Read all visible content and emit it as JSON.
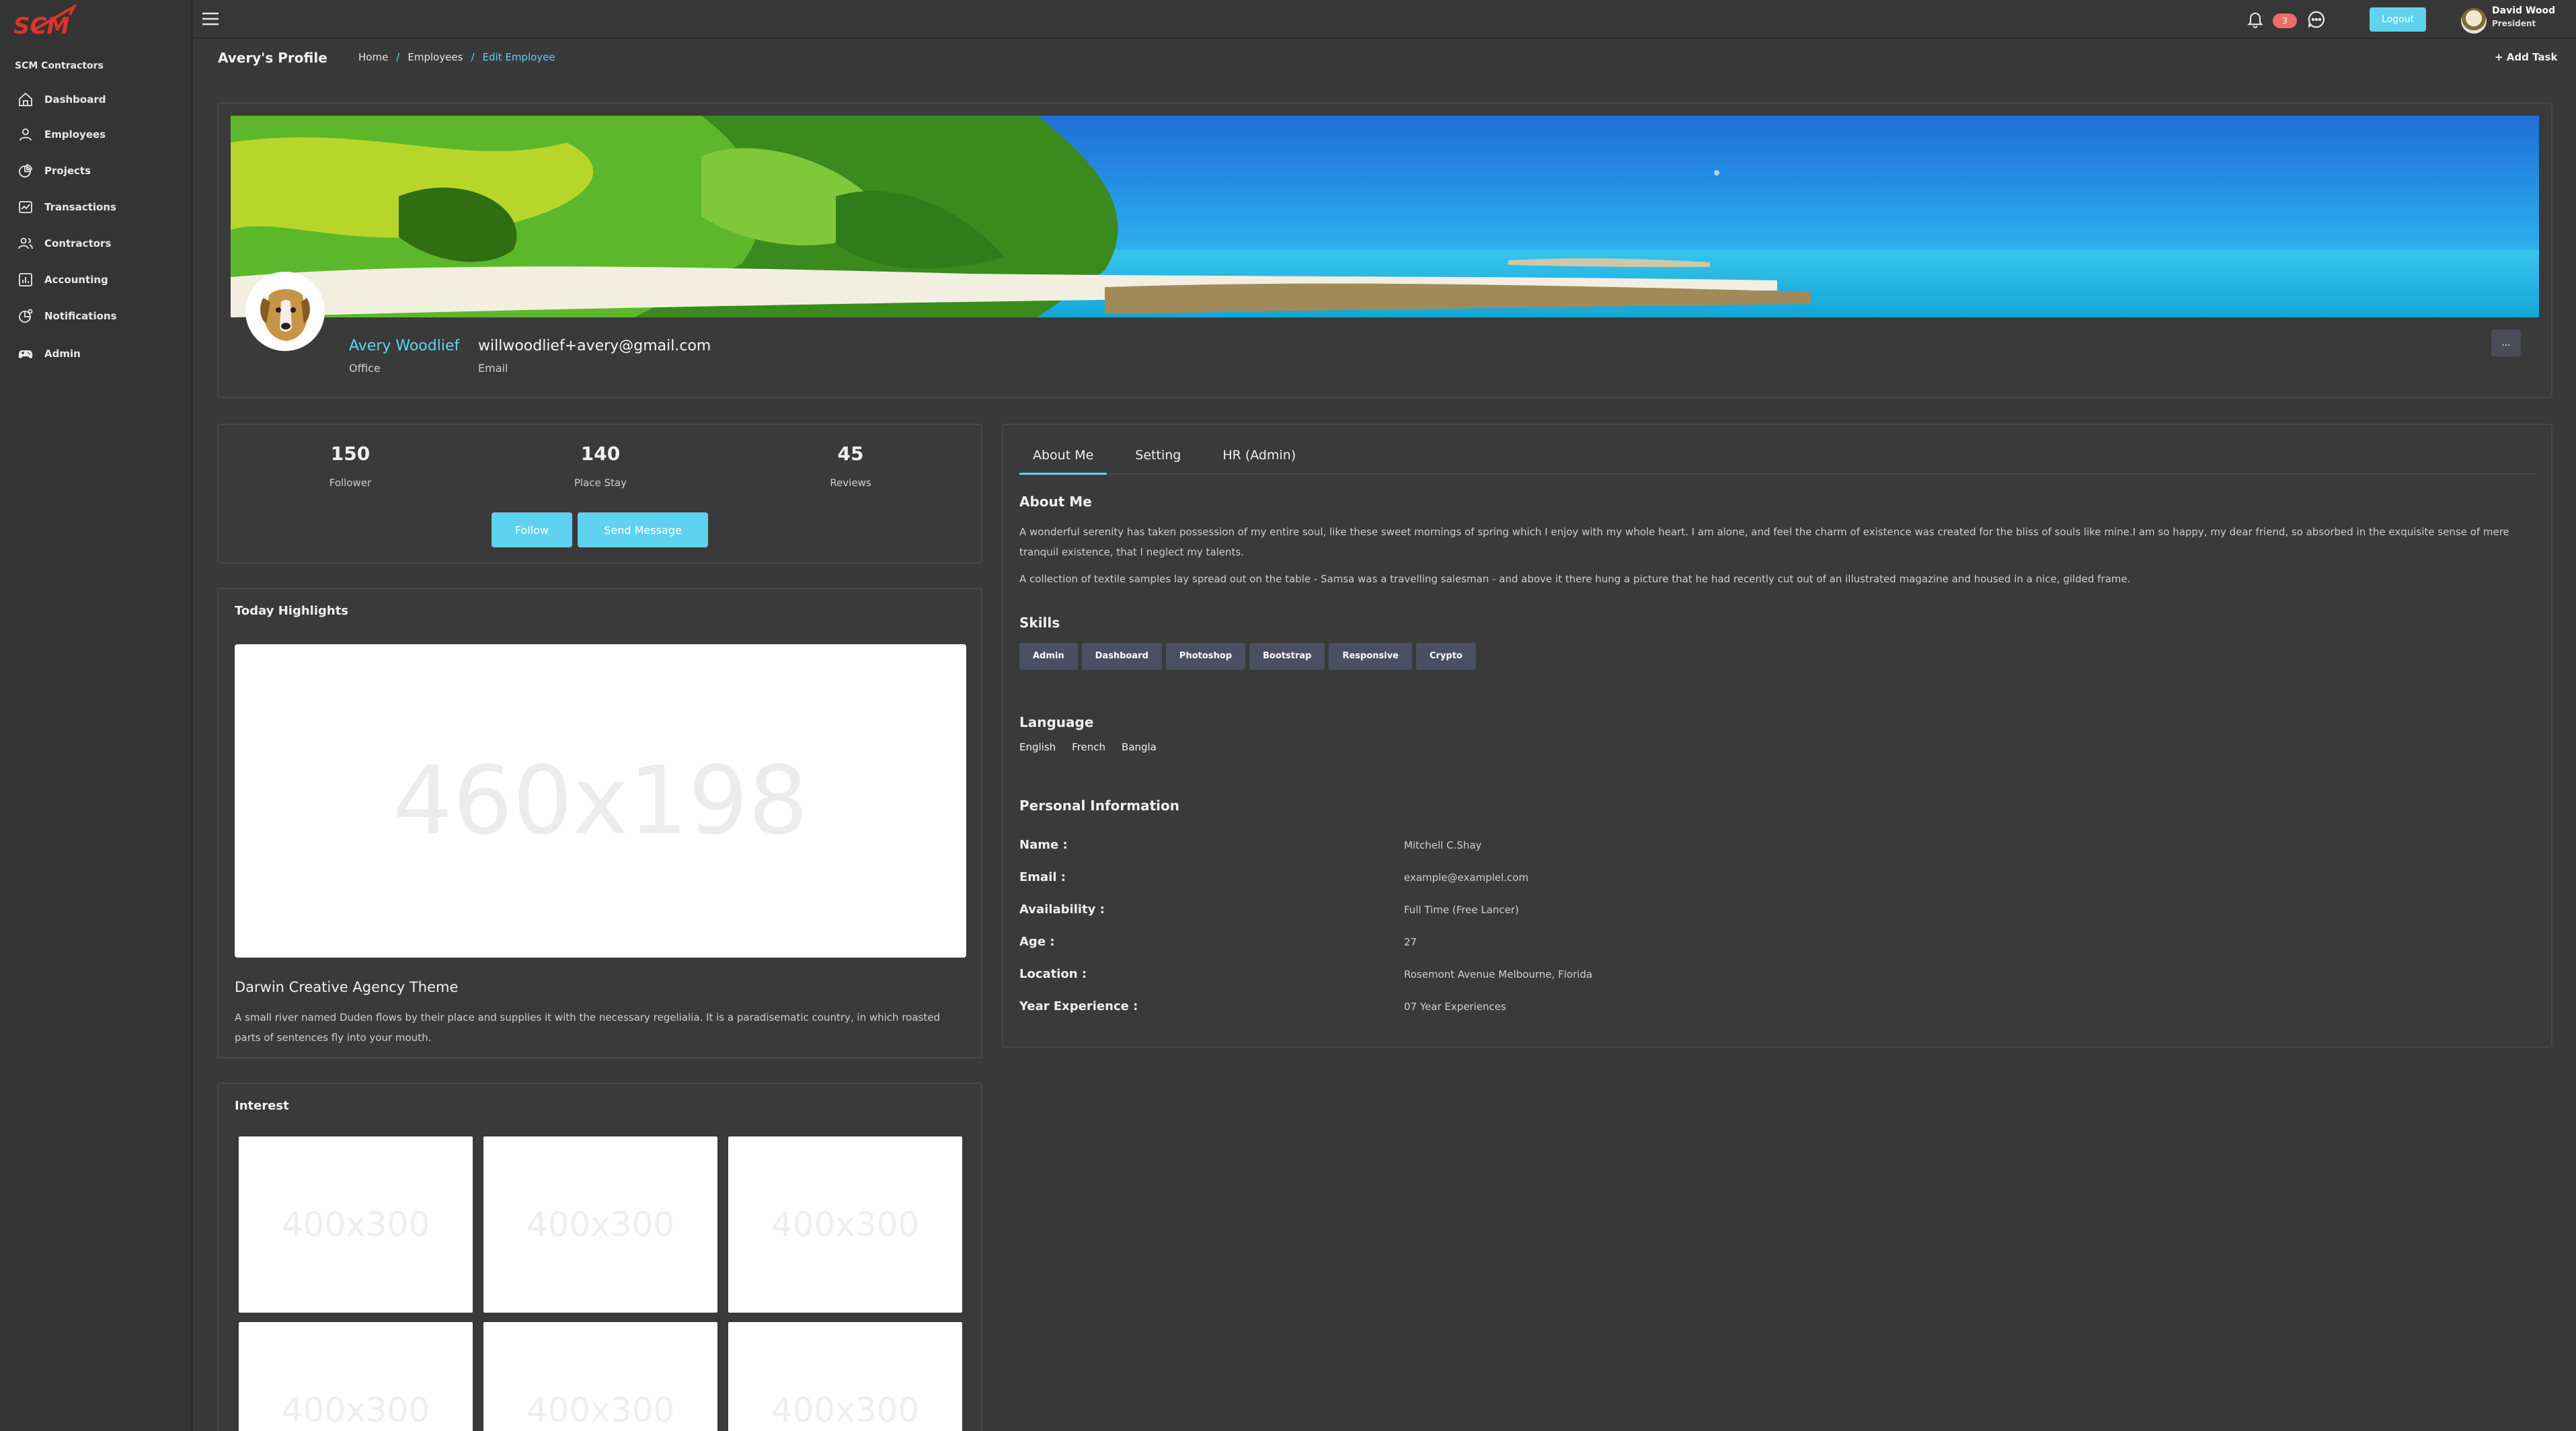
{
  "brand": {
    "logo_text": "SCM",
    "company": "SCM Contractors"
  },
  "sidebar": {
    "items": [
      {
        "label": "Dashboard",
        "icon": "home-icon"
      },
      {
        "label": "Employees",
        "icon": "user-icon"
      },
      {
        "label": "Projects",
        "icon": "projects-icon"
      },
      {
        "label": "Transactions",
        "icon": "transactions-icon"
      },
      {
        "label": "Contractors",
        "icon": "users-icon"
      },
      {
        "label": "Accounting",
        "icon": "chart-icon"
      },
      {
        "label": "Notifications",
        "icon": "notification-icon"
      },
      {
        "label": "Admin",
        "icon": "gamepad-icon"
      }
    ]
  },
  "topbar": {
    "notification_count": "3",
    "logout_label": "Logout",
    "user": {
      "name": "David Wood",
      "role": "President"
    }
  },
  "header": {
    "title": "Avery's Profile",
    "breadcrumb": [
      "Home",
      "Employees",
      "Edit Employee"
    ],
    "separator": "/",
    "add_task": "+ Add Task"
  },
  "profile": {
    "name": "Avery Woodlief",
    "name_caption": "Office",
    "email": "willwoodlief+avery@gmail.com",
    "email_caption": "Email",
    "more_label": "..."
  },
  "stats": [
    {
      "value": "150",
      "label": "Follower"
    },
    {
      "value": "140",
      "label": "Place Stay"
    },
    {
      "value": "45",
      "label": "Reviews"
    }
  ],
  "actions": {
    "follow": "Follow",
    "message": "Send Message"
  },
  "highlights": {
    "title": "Today Highlights",
    "image_placeholder": "460x198",
    "post_title": "Darwin Creative Agency Theme",
    "post_desc": "A small river named Duden flows by their place and supplies it with the necessary regelialia. It is a paradisematic country, in which roasted parts of sentences fly into your mouth."
  },
  "interest": {
    "title": "Interest",
    "placeholders": [
      "400x300",
      "400x300",
      "400x300",
      "400x300",
      "400x300",
      "400x300"
    ]
  },
  "about": {
    "tabs": [
      "About Me",
      "Setting",
      "HR (Admin)"
    ],
    "title": "About Me",
    "para1": "A wonderful serenity has taken possession of my entire soul, like these sweet mornings of spring which I enjoy with my whole heart. I am alone, and feel the charm of existence was created for the bliss of souls like mine.I am so happy, my dear friend, so absorbed in the exquisite sense of mere tranquil existence, that I neglect my talents.",
    "para2": "A collection of textile samples lay spread out on the table - Samsa was a travelling salesman - and above it there hung a picture that he had recently cut out of an illustrated magazine and housed in a nice, gilded frame.",
    "skills_title": "Skills",
    "skills": [
      "Admin",
      "Dashboard",
      "Photoshop",
      "Bootstrap",
      "Responsive",
      "Crypto"
    ],
    "language_title": "Language",
    "languages": [
      "English",
      "French",
      "Bangla"
    ],
    "personal_title": "Personal Information",
    "personal": [
      {
        "label": "Name :",
        "value": "Mitchell C.Shay"
      },
      {
        "label": "Email :",
        "value": "example@examplel.com"
      },
      {
        "label": "Availability :",
        "value": "Full Time (Free Lancer)"
      },
      {
        "label": "Age :",
        "value": "27"
      },
      {
        "label": "Location :",
        "value": "Rosemont Avenue Melbourne, Florida"
      },
      {
        "label": "Year Experience :",
        "value": "07 Year Experiences"
      }
    ]
  },
  "colors": {
    "accent": "#5fd2ef",
    "brand_red": "#e0322d",
    "badge": "#ee6c6c",
    "skill_bg": "#4a5062"
  }
}
